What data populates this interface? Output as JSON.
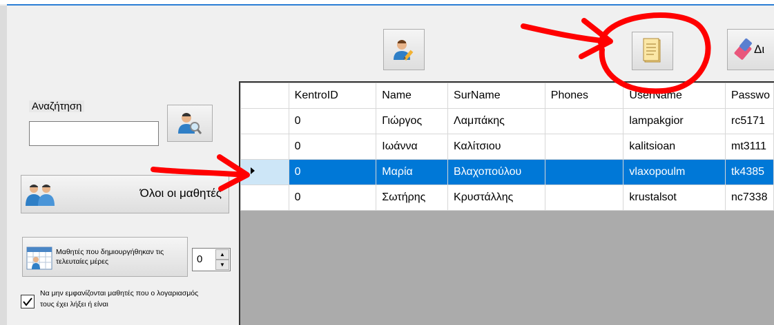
{
  "search": {
    "label": "Αναζήτηση",
    "value": ""
  },
  "buttons": {
    "all_students": "Όλοι οι μαθητές",
    "recent_students": "Μαθητές που δημιουργήθηκαν τις τελευταίες μέρες",
    "partial_toolbar_label": "Δι"
  },
  "days_spinner": {
    "value": "0"
  },
  "hide_expired": {
    "label": "Να μην εμφανίζονται μαθητές που ο λογαριασμός τους έχει λήξει ή είναι",
    "checked": true
  },
  "grid": {
    "columns": [
      "KentroID",
      "Name",
      "SurName",
      "Phones",
      "UserName",
      "Passwo"
    ],
    "rows": [
      [
        "0",
        "Γιώργος",
        "Λαμπάκης",
        "",
        "lampakgior",
        "rc5171"
      ],
      [
        "0",
        "Ιωάννα",
        "Καλίτσιου",
        "",
        "kalitsioan",
        "mt3111"
      ],
      [
        "0",
        "Μαρία",
        "Βλαχοπούλου",
        "",
        "vlaxopoulm",
        "tk4385"
      ],
      [
        "0",
        "Σωτήρης",
        "Κρυστάλλης",
        "",
        "krustalsot",
        "nc7338"
      ]
    ],
    "selected_row": 2
  },
  "colors": {
    "selection": "#0078d7",
    "accent_line": "#2a7dd4",
    "annotation": "#ff0000"
  }
}
